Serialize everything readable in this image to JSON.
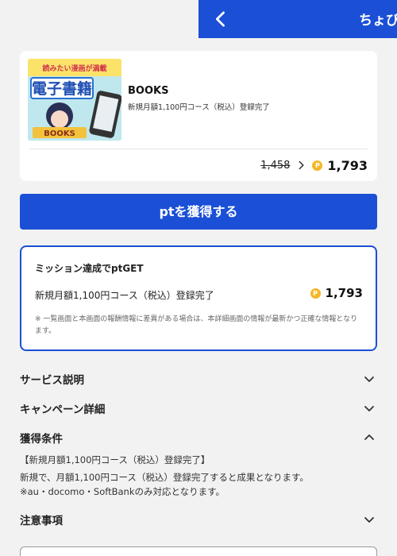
{
  "header": {
    "title": "ちょび"
  },
  "offer": {
    "thumb_caption": "読みたい漫画が満載",
    "thumb_title": "電子書籍",
    "thumb_books": "BOOKS",
    "name": "BOOKS",
    "description": "新規月額1,100円コース（税込）登録完了",
    "old_price": "1,458",
    "new_price": "1,793",
    "coin_label": "P"
  },
  "get_button": {
    "label": "ptを獲得する"
  },
  "mission": {
    "title": "ミッション達成でptGET",
    "condition": "新規月額1,100円コース（税込）登録完了",
    "reward": "1,793",
    "coin_label": "P",
    "note": "※ 一覧画面と本画面の報酬情報に差異がある場合は、本詳細画面の情報が最新かつ正確な情報となります。"
  },
  "accordions": {
    "service": {
      "label": "サービス説明",
      "expanded": false
    },
    "campaign": {
      "label": "キャンペーン詳細",
      "expanded": false
    },
    "conditions": {
      "label": "獲得条件",
      "expanded": true,
      "heading": "【新規月額1,100円コース（税込）登録完了】",
      "line1": "新規で、月額1,100円コース（税込）登録完了すると成果となります。",
      "line2": "※au・docomo・SoftBankのみ対応となります。"
    },
    "notes": {
      "label": "注意事項",
      "expanded": false
    }
  },
  "colors": {
    "accent": "#1a4fd6",
    "coin": "#f5b728",
    "background": "#f2f2f2"
  }
}
